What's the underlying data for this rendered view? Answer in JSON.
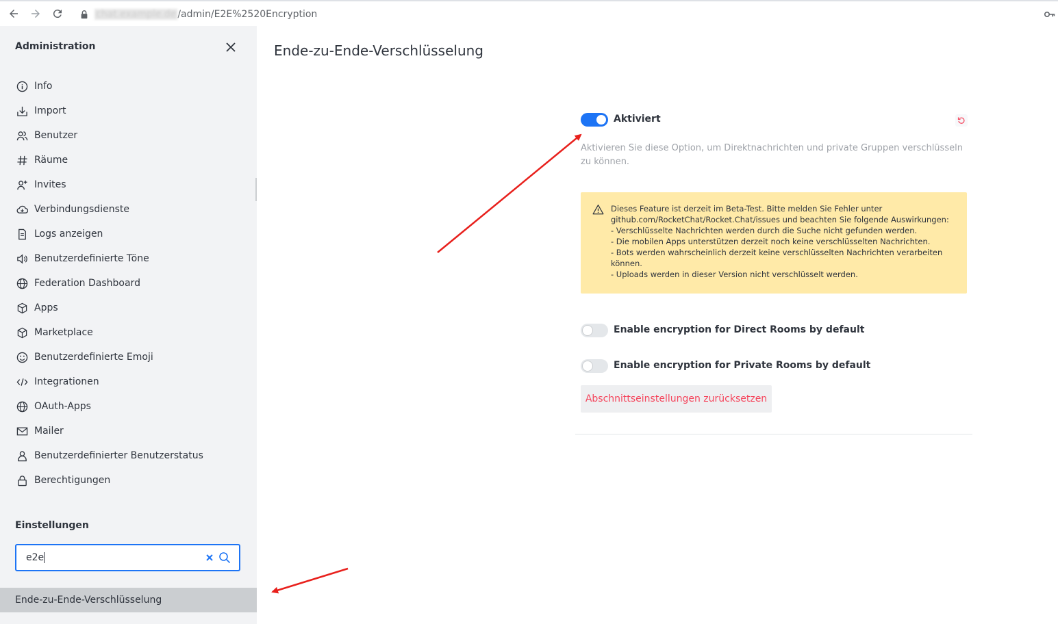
{
  "browser": {
    "host": "chat.example.de",
    "path": "/admin/E2E%2520Encryption"
  },
  "sidebar": {
    "header": "Administration",
    "items": [
      {
        "label": "Info",
        "icon": "info-circle-icon"
      },
      {
        "label": "Import",
        "icon": "import-icon"
      },
      {
        "label": "Benutzer",
        "icon": "users-icon"
      },
      {
        "label": "Räume",
        "icon": "hashtag-icon"
      },
      {
        "label": "Invites",
        "icon": "user-plus-icon"
      },
      {
        "label": "Verbindungsdienste",
        "icon": "cloud-icon"
      },
      {
        "label": "Logs anzeigen",
        "icon": "document-icon"
      },
      {
        "label": "Benutzerdefinierte Töne",
        "icon": "speaker-icon"
      },
      {
        "label": "Federation Dashboard",
        "icon": "globe-icon"
      },
      {
        "label": "Apps",
        "icon": "cube-icon"
      },
      {
        "label": "Marketplace",
        "icon": "cube-icon"
      },
      {
        "label": "Benutzerdefinierte Emoji",
        "icon": "emoji-icon"
      },
      {
        "label": "Integrationen",
        "icon": "code-icon"
      },
      {
        "label": "OAuth-Apps",
        "icon": "globe-icon"
      },
      {
        "label": "Mailer",
        "icon": "mail-icon"
      },
      {
        "label": "Benutzerdefinierter Benutzerstatus",
        "icon": "user-icon"
      },
      {
        "label": "Berechtigungen",
        "icon": "lock-icon"
      }
    ],
    "settings_header": "Einstellungen",
    "search_value": "e2e",
    "search_result": "Ende-zu-Ende-Verschlüsselung"
  },
  "main": {
    "title": "Ende-zu-Ende-Verschlüsselung",
    "enabled_label": "Aktiviert",
    "enabled_value": true,
    "enabled_hint": "Aktivieren Sie diese Option, um Direktnachrichten und private Gruppen verschlüsseln zu können.",
    "warning_lines": [
      "Dieses Feature ist derzeit im Beta-Test. Bitte melden Sie Fehler unter",
      "github.com/RocketChat/Rocket.Chat/issues und beachten Sie folgende Auswirkungen:",
      "- Verschlüsselte Nachrichten werden durch die Suche nicht gefunden werden.",
      "- Die mobilen Apps unterstützen derzeit noch keine verschlüsselten Nachrichten.",
      "- Bots werden wahrscheinlich derzeit keine verschlüsselten Nachrichten verarbeiten",
      "können.",
      "- Uploads werden in dieser Version nicht verschlüsselt werden."
    ],
    "direct_rooms_label": "Enable encryption for Direct Rooms by default",
    "direct_rooms_value": false,
    "private_rooms_label": "Enable encryption for Private Rooms by default",
    "private_rooms_value": false,
    "reset_section_label": "Abschnittseinstellungen zurücksetzen"
  },
  "colors": {
    "accent": "#1d74f5",
    "danger": "#f5455c",
    "warning_bg": "#ffeaa8",
    "annotation": "#e8201c"
  }
}
